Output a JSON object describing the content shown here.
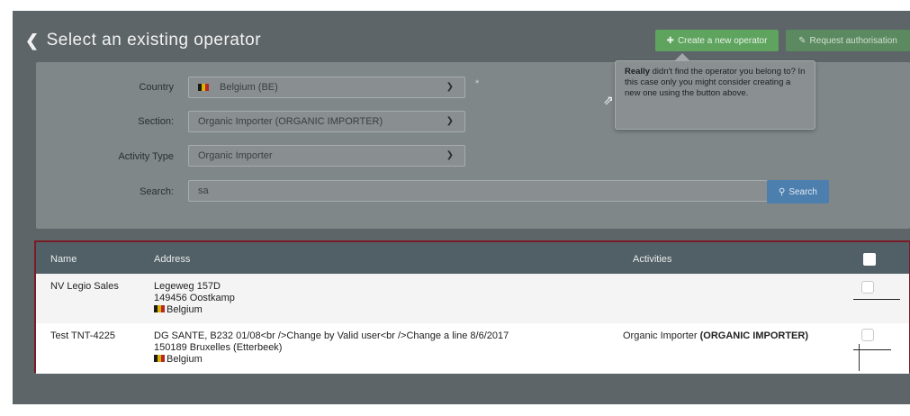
{
  "header": {
    "back_icon": "chevron-left-icon",
    "title": "Select an existing operator",
    "create_button": "Create a new operator",
    "request_button": "Request authorisation"
  },
  "form": {
    "country_label": "Country",
    "country_value": "Belgium (BE)",
    "required_marker": "*",
    "section_label": "Section:",
    "section_value": "Organic Importer (ORGANIC IMPORTER)",
    "activity_label": "Activity Type",
    "activity_value": "Organic Importer",
    "search_label": "Search:",
    "search_value": "sa",
    "search_button": "Search"
  },
  "tooltip": {
    "bold": "Really",
    "text": " didn't find the operator you belong to? In this case only you might consider creating a new one using the button above."
  },
  "table": {
    "headers": {
      "name": "Name",
      "address": "Address",
      "activities": "Activities"
    },
    "rows": [
      {
        "name": "NV Legio Sales",
        "address_line1": "Legeweg 157D",
        "address_line2": "149456 Oostkamp",
        "country": "Belgium",
        "activity": "",
        "activity_bold": ""
      },
      {
        "name": "Test TNT-4225",
        "address_line1": "DG SANTE, B232 01/08<br />Change by Valid user<br />Change a line 8/6/2017",
        "address_line2": "150189 Bruxelles (Etterbeek)",
        "country": "Belgium",
        "activity": "Organic Importer ",
        "activity_bold": "(ORGANIC IMPORTER)"
      }
    ]
  },
  "colors": {
    "create_green": "#5ea35e",
    "search_blue": "#4d7fae",
    "table_border": "#7a1c27"
  }
}
